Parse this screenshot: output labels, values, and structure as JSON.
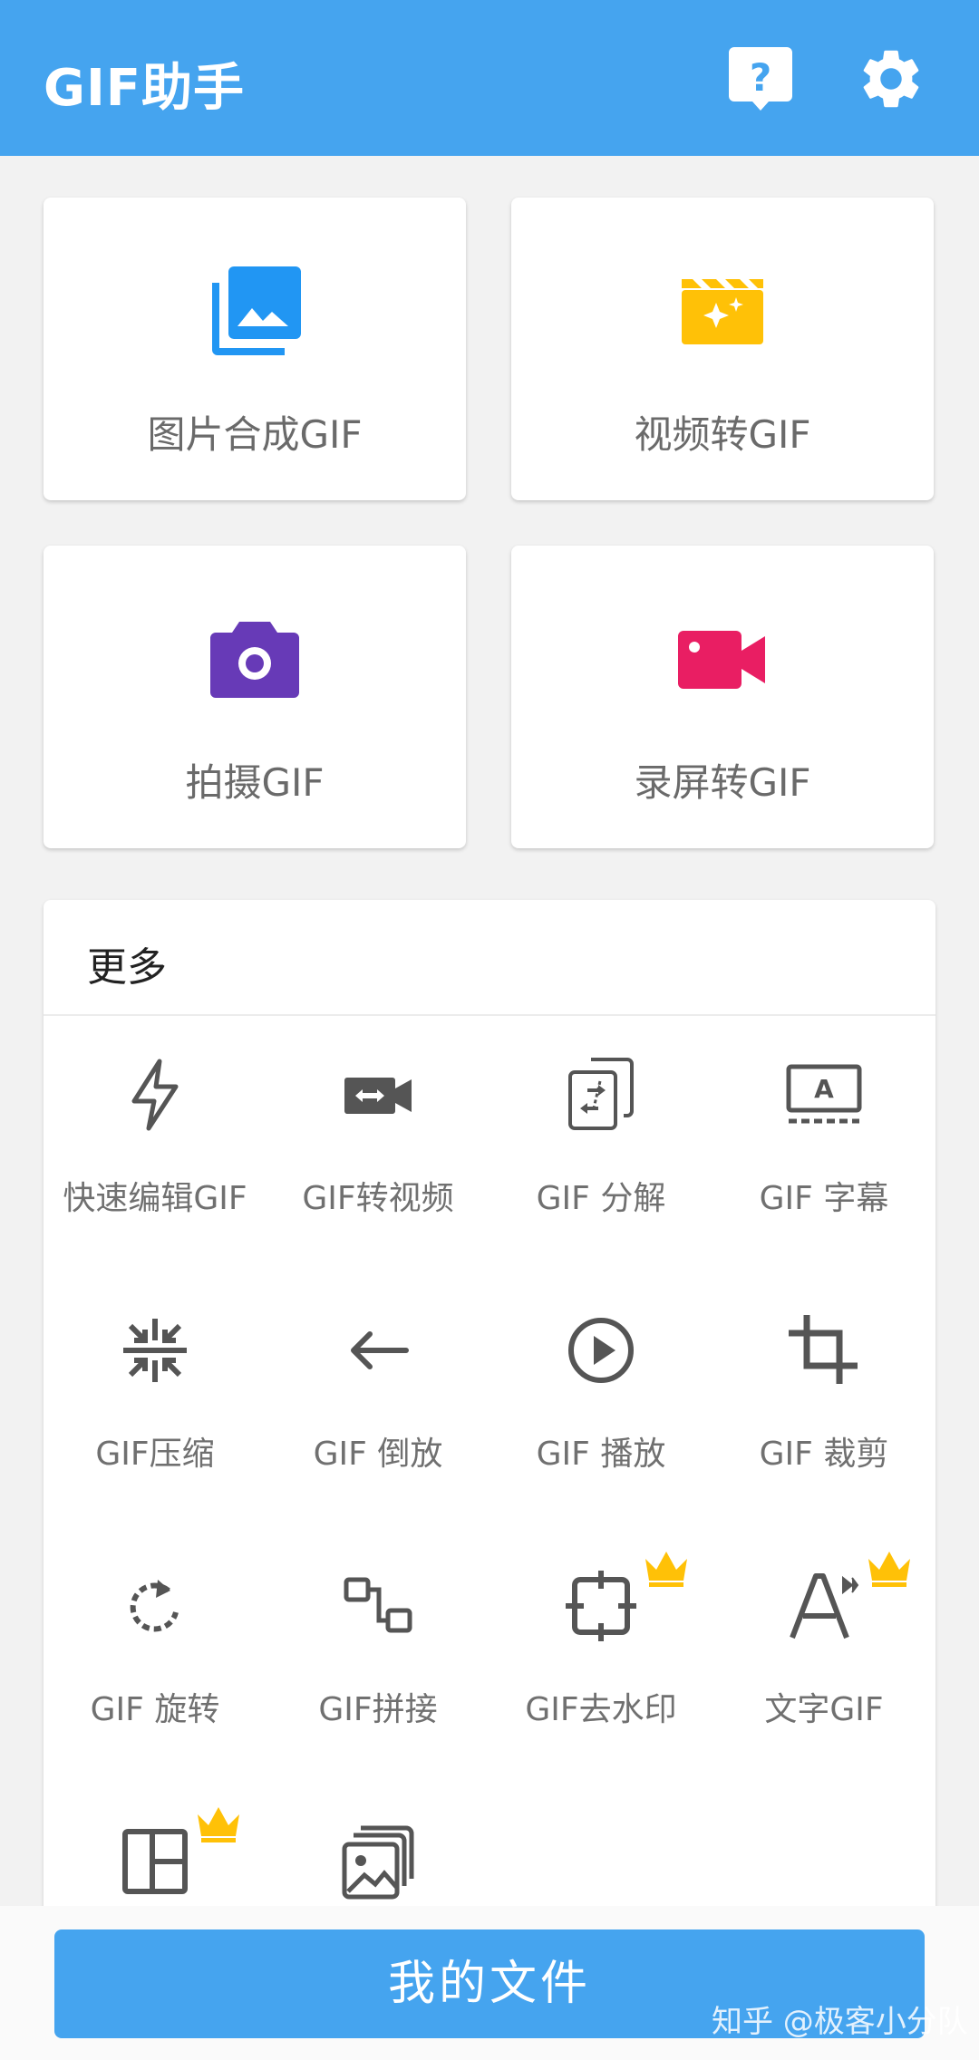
{
  "app": {
    "title": "GIF助手",
    "accent_color": "#45a4ef",
    "help_icon": "help-icon",
    "settings_icon": "gear-icon"
  },
  "cards": [
    {
      "label": "图片合成GIF",
      "icon": "photo-library-icon",
      "color": "#2196f3"
    },
    {
      "label": "视频转GIF",
      "icon": "movie-sparkle-icon",
      "color": "#ffc107"
    },
    {
      "label": "拍摄GIF",
      "icon": "camera-icon",
      "color": "#673ab7"
    },
    {
      "label": "录屏转GIF",
      "icon": "videocam-icon",
      "color": "#e91e63"
    }
  ],
  "more": {
    "title": "更多",
    "tools": [
      {
        "label": "快速编辑GIF",
        "icon": "flash-icon",
        "premium": false
      },
      {
        "label": "GIF转视频",
        "icon": "video-convert-icon",
        "premium": false
      },
      {
        "label": "GIF 分解",
        "icon": "split-icon",
        "premium": false
      },
      {
        "label": "GIF 字幕",
        "icon": "subtitles-icon",
        "premium": false
      },
      {
        "label": "GIF压缩",
        "icon": "compress-icon",
        "premium": false
      },
      {
        "label": "GIF 倒放",
        "icon": "arrow-left-icon",
        "premium": false
      },
      {
        "label": "GIF 播放",
        "icon": "play-circle-icon",
        "premium": false
      },
      {
        "label": "GIF 裁剪",
        "icon": "crop-icon",
        "premium": false
      },
      {
        "label": "GIF 旋转",
        "icon": "rotate-icon",
        "premium": false
      },
      {
        "label": "GIF拼接",
        "icon": "join-icon",
        "premium": false
      },
      {
        "label": "GIF去水印",
        "icon": "watermark-remove-icon",
        "premium": true
      },
      {
        "label": "文字GIF",
        "icon": "text-icon",
        "premium": true
      },
      {
        "label": "",
        "icon": "layout-icon",
        "premium": true
      },
      {
        "label": "",
        "icon": "image-stack-icon",
        "premium": false
      }
    ]
  },
  "bottom": {
    "files_label": "我的文件"
  },
  "watermark": "知乎 @极客小分队"
}
